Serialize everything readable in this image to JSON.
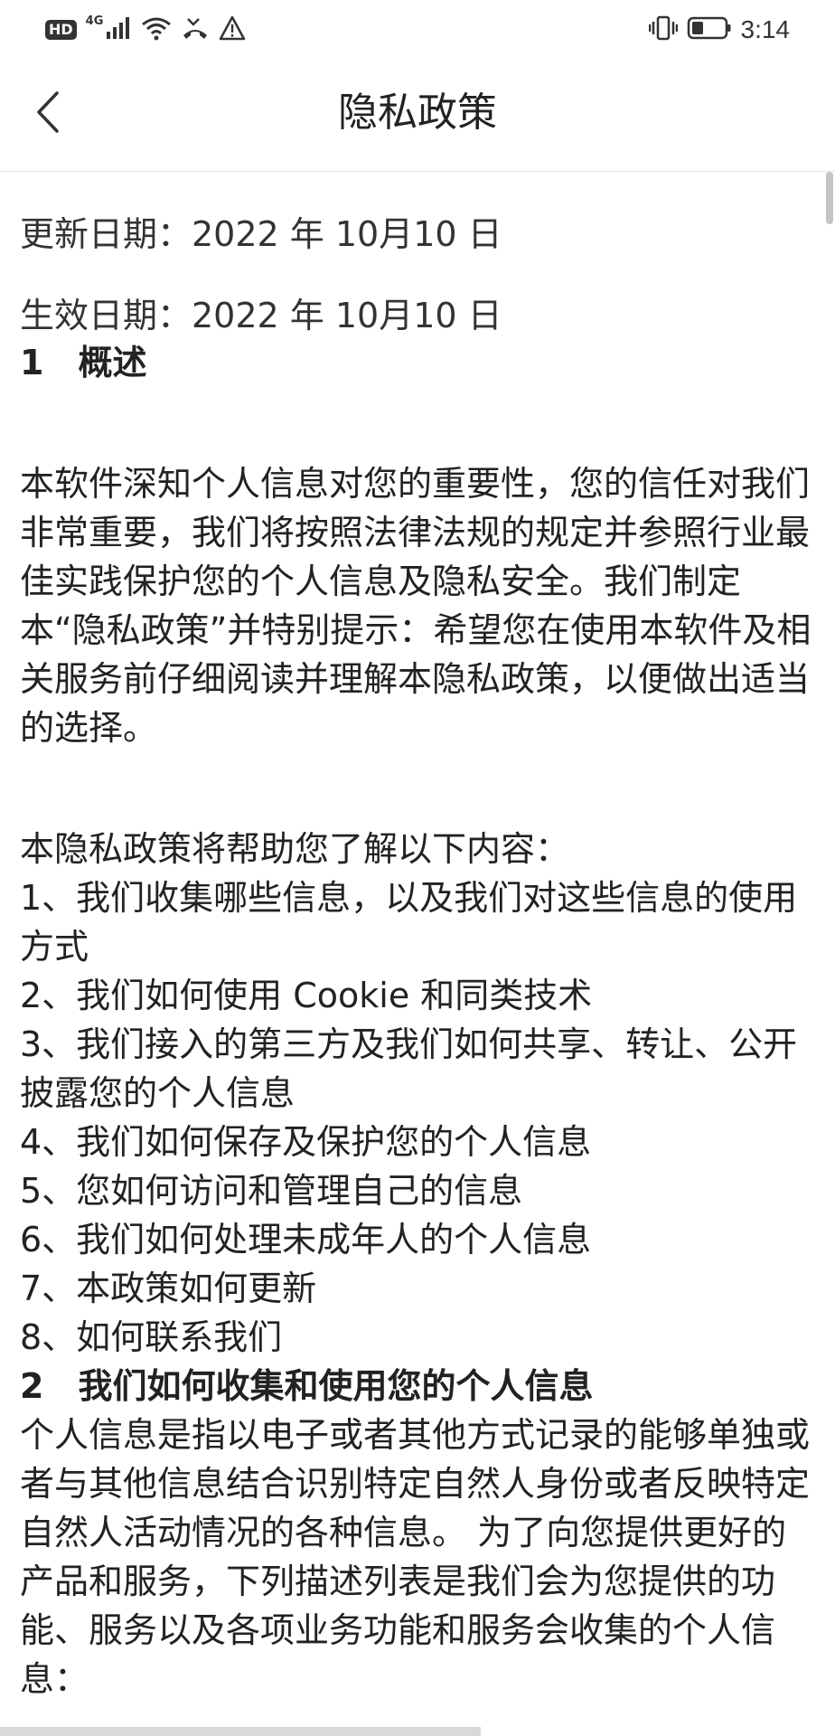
{
  "status_bar": {
    "hd": "HD",
    "network": "4G",
    "time": "3:14",
    "icons": [
      "signal-icon",
      "wifi-icon",
      "missed-call-icon",
      "warning-icon",
      "vibrate-icon",
      "battery-icon"
    ]
  },
  "header": {
    "title": "隐私政策",
    "back_icon": "chevron-left-icon"
  },
  "document": {
    "update_date": "更新日期：2022 年 10月10 日",
    "effective_date": "生效日期：2022 年 10月10 日",
    "section1_title": "1　概述",
    "intro": "本软件深知个人信息对您的重要性，您的信任对我们非常重要，我们将按照法律法规的规定并参照行业最佳实践保护您的个人信息及隐私安全。我们制定本“隐私政策”并特别提示：希望您在使用本软件及相关服务前仔细阅读并理解本隐私政策，以便做出适当的选择。",
    "contents_intro": "本隐私政策将帮助您了解以下内容：",
    "items": [
      "1、我们收集哪些信息，以及我们对这些信息的使用方式",
      "2、我们如何使用 Cookie 和同类技术",
      "3、我们接入的第三方及我们如何共享、转让、公开披露您的个人信息",
      "4、我们如何保存及保护您的个人信息",
      "5、您如何访问和管理自己的信息",
      "6、我们如何处理未成年人的个人信息",
      "7、本政策如何更新",
      "8、如何联系我们"
    ],
    "section2_title": "2　我们如何收集和使用您的个人信息",
    "section2_body": "个人信息是指以电子或者其他方式记录的能够单独或者与其他信息结合识别特定自然人身份或者反映特定自然人活动情况的各种信息。 为了向您提供更好的产品和服务，下列描述列表是我们会为您提供的功能、服务以及各项业务功能和服务会收集的个人信息："
  }
}
